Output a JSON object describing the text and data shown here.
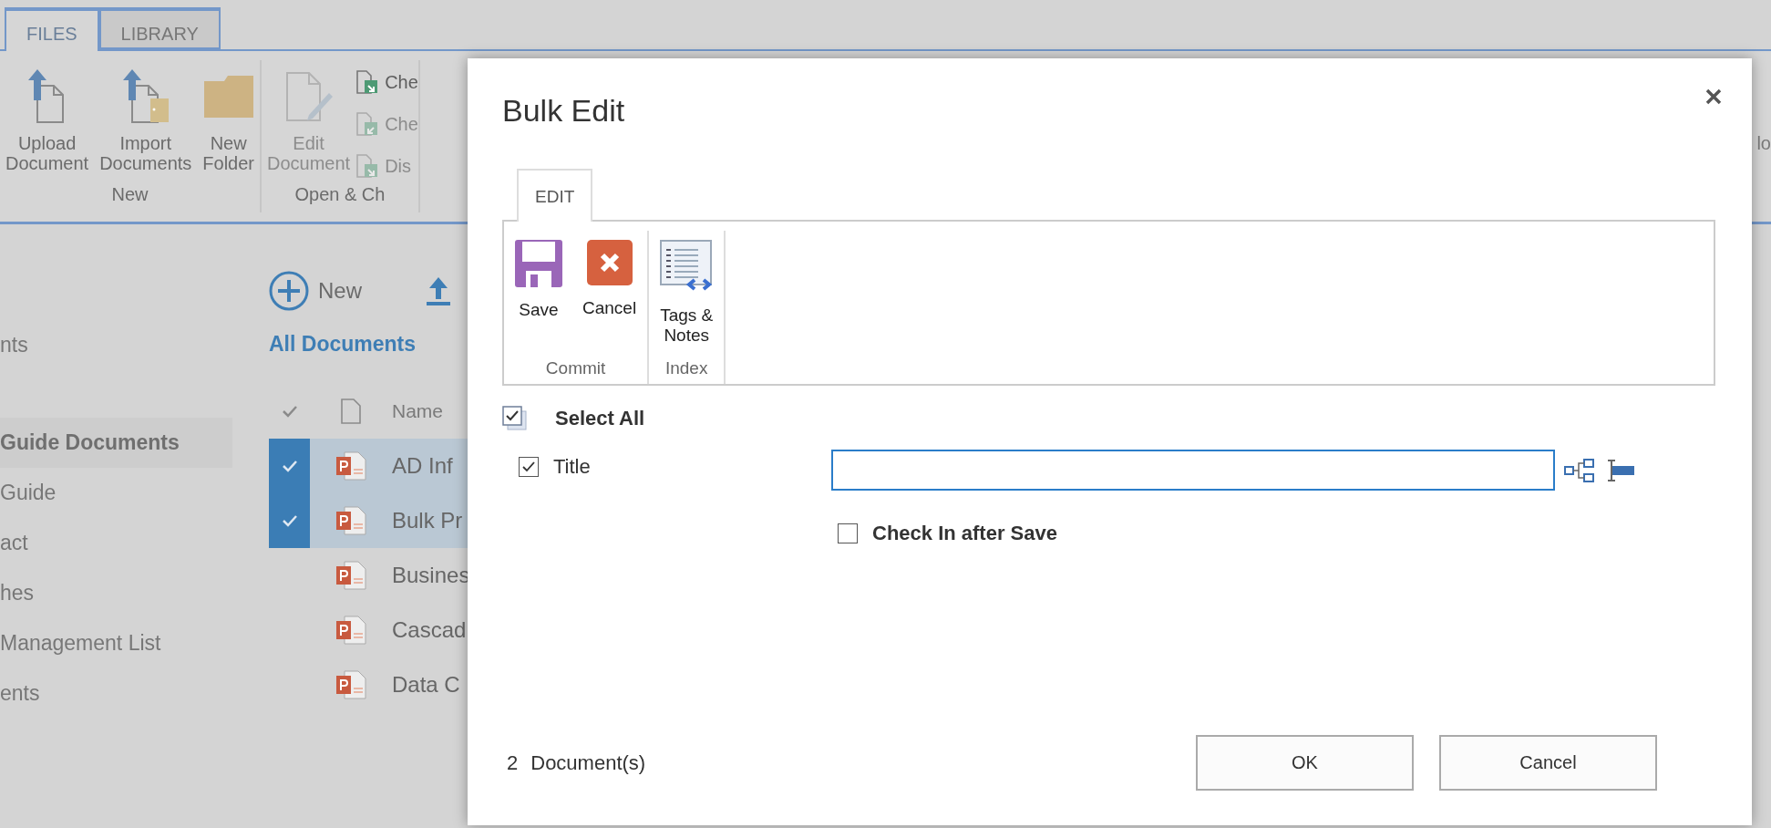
{
  "page": {
    "ribbon_tabs": [
      {
        "label": "FILES",
        "selected": true
      },
      {
        "label": "LIBRARY",
        "selected": false
      }
    ],
    "ribbon_groups": [
      {
        "label": "New",
        "large_buttons": [
          {
            "kind": "upload",
            "label": "Upload\nDocument",
            "disabled": false
          },
          {
            "kind": "import",
            "label": "Import\nDocuments",
            "disabled": false
          },
          {
            "kind": "folder",
            "label": "New\nFolder",
            "disabled": false
          }
        ]
      },
      {
        "label": "Open & Ch",
        "large_buttons": [
          {
            "kind": "edit",
            "label": "Edit\nDocument",
            "disabled": true
          }
        ],
        "small_buttons": [
          {
            "kind": "check-out",
            "label": "Che",
            "disabled": false
          },
          {
            "kind": "check-in",
            "label": "Che",
            "disabled": true
          },
          {
            "kind": "discard",
            "label": "Dis",
            "disabled": true
          }
        ]
      }
    ],
    "ribbon_edge_label": "lo",
    "nav_items": [
      {
        "label": "nts",
        "selected": false
      },
      {
        "label": "Guide Documents",
        "selected": true
      },
      {
        "label": "Guide",
        "selected": false
      },
      {
        "label": "act",
        "selected": false
      },
      {
        "label": "hes",
        "selected": false
      },
      {
        "label": "Management List",
        "selected": false
      },
      {
        "label": "ents",
        "selected": false
      }
    ],
    "toolbar": [
      {
        "kind": "new",
        "label": "New"
      },
      {
        "kind": "upload"
      }
    ],
    "view_label": "All Documents",
    "list": {
      "columns": [
        "Name"
      ],
      "rows": [
        {
          "name": "AD Inf",
          "selected": true
        },
        {
          "name": "Bulk Pr",
          "selected": true
        },
        {
          "name": "Busines",
          "selected": false
        },
        {
          "name": "Cascad",
          "selected": false
        },
        {
          "name": "Data C",
          "selected": false
        }
      ]
    }
  },
  "dialog": {
    "title": "Bulk Edit",
    "ribbon_tabs": [
      {
        "label": "EDIT",
        "selected": true
      }
    ],
    "ribbon_groups": [
      {
        "label": "Commit",
        "buttons": [
          {
            "kind": "save",
            "label": "Save"
          },
          {
            "kind": "cancel",
            "label": "Cancel"
          }
        ]
      },
      {
        "label": "Index",
        "buttons": [
          {
            "kind": "tags",
            "label": "Tags &\nNotes"
          }
        ]
      }
    ],
    "select_all": {
      "label": "Select All"
    },
    "fields": [
      {
        "label": "Title",
        "checked": true
      }
    ],
    "check_in": {
      "label": "Check In after Save",
      "checked": false
    },
    "footer": {
      "count": "2",
      "count_label": "Document(s)"
    },
    "buttons": [
      {
        "label": "OK"
      },
      {
        "label": "Cancel"
      }
    ]
  }
}
